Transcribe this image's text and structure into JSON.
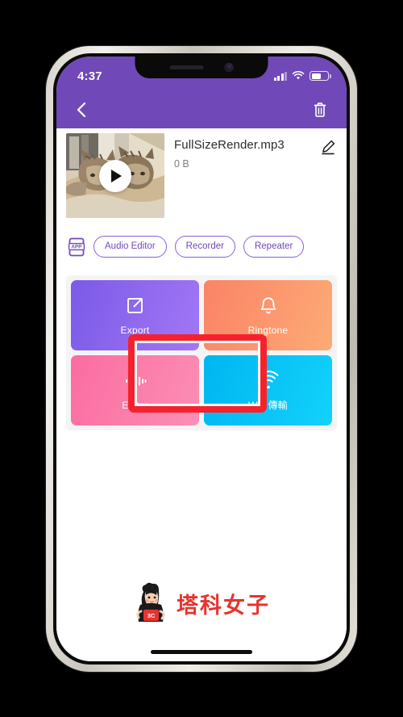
{
  "status_bar": {
    "time": "4:37",
    "signal_icon": "cellular-signal-icon",
    "wifi_icon": "wifi-icon",
    "battery_icon": "battery-icon",
    "battery_level_percent": 60
  },
  "app_bar": {
    "back_icon": "chevron-left-icon",
    "delete_icon": "trash-icon",
    "background_color": "#7048b8"
  },
  "file": {
    "name": "FullSizeRender.mp3",
    "size": "0 B",
    "thumbnail_alt": "two-tabby-cats-in-cat-bed",
    "play_icon": "play-icon",
    "edit_icon": "pencil-edit-icon"
  },
  "chips": {
    "app_badge_icon": "app-phone-icon",
    "app_badge_label": "APP",
    "items": [
      {
        "label": "Audio Editor",
        "name": "chip-audio-editor"
      },
      {
        "label": "Recorder",
        "name": "chip-recorder"
      },
      {
        "label": "Repeater",
        "name": "chip-repeater"
      }
    ]
  },
  "action_grid": {
    "tiles": [
      {
        "label": "Export",
        "icon": "external-link-icon",
        "color_from": "#7b5ae8",
        "color_to": "#a277f5",
        "highlighted": true
      },
      {
        "label": "Ringtone",
        "icon": "bell-icon",
        "color_from": "#fb8367",
        "color_to": "#fcab75",
        "highlighted": false
      },
      {
        "label": "Editor",
        "icon": "waveform-icon",
        "color_from": "#fb6ca0",
        "color_to": "#fb8fb5",
        "highlighted": false
      },
      {
        "label": "Wifi 傳輸",
        "icon": "wifi-icon",
        "color_from": "#00b6f0",
        "color_to": "#12d2fb",
        "highlighted": false
      }
    ],
    "highlight_color": "#f5222d"
  },
  "watermark": {
    "text": "塔科女子",
    "mascot_badge": "3C",
    "color": "#e8332e"
  }
}
